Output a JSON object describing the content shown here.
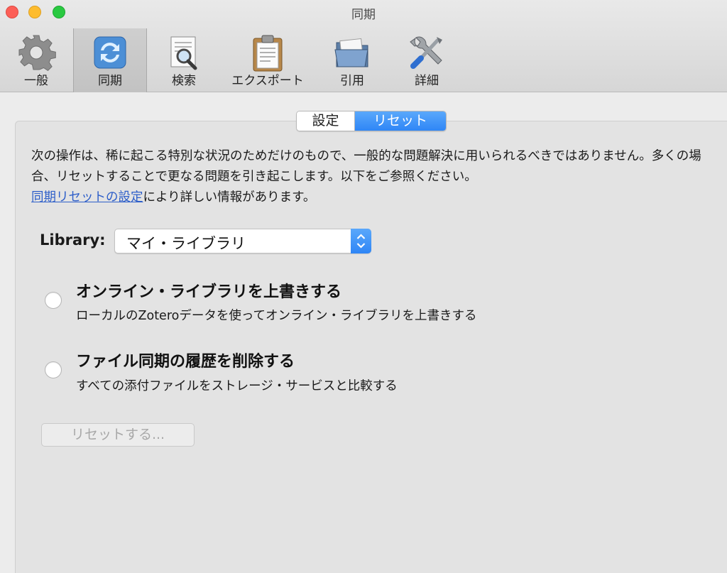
{
  "window": {
    "title": "同期"
  },
  "toolbar": {
    "items": [
      {
        "label": "一般",
        "icon": "gear-icon"
      },
      {
        "label": "同期",
        "icon": "sync-icon",
        "selected": true
      },
      {
        "label": "検索",
        "icon": "search-document-icon"
      },
      {
        "label": "エクスポート",
        "icon": "clipboard-icon"
      },
      {
        "label": "引用",
        "icon": "folder-icon"
      },
      {
        "label": "詳細",
        "icon": "tools-icon"
      }
    ]
  },
  "tabs": [
    {
      "label": "設定",
      "active": false
    },
    {
      "label": "リセット",
      "active": true
    }
  ],
  "description": {
    "text": "次の操作は、稀に起こる特別な状況のためだけのもので、一般的な問題解決に用いられるべきではありません。多くの場合、リセットすることで更なる問題を引き起こします。以下をご参照ください。",
    "link": "同期リセットの設定",
    "after_link": "により詳しい情報があります。"
  },
  "library": {
    "label": "Library:",
    "value": "マイ・ライブラリ"
  },
  "options": [
    {
      "title": "オンライン・ライブラリを上書きする",
      "subtitle": "ローカルのZoteroデータを使ってオンライン・ライブラリを上書きする"
    },
    {
      "title": "ファイル同期の履歴を削除する",
      "subtitle": "すべての添付ファイルをストレージ・サービスと比較する"
    }
  ],
  "reset_button": {
    "label": "リセットする..."
  },
  "colors": {
    "accent": "#2f86f6",
    "link": "#2d5ec9"
  }
}
